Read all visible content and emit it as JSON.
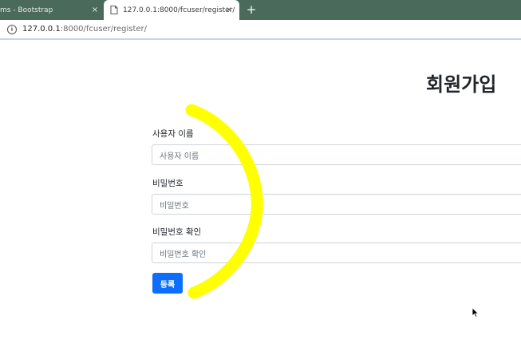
{
  "browser": {
    "tabs": [
      {
        "title": "ms - Bootstrap",
        "active": false
      },
      {
        "title": "127.0.0.1:8000/fcuser/register/",
        "active": true
      }
    ],
    "close_glyph": "×",
    "new_tab_glyph": "+",
    "address": {
      "host": "127.0.0.1",
      "path": ":8000/fcuser/register/"
    },
    "info_glyph": "i"
  },
  "page": {
    "title": "회원가입",
    "fields": [
      {
        "label": "사용자 이름",
        "placeholder": "사용자 이름"
      },
      {
        "label": "비밀번호",
        "placeholder": "비밀번호"
      },
      {
        "label": "비밀번호 확인",
        "placeholder": "비밀번호 확인"
      }
    ],
    "submit_label": "등록"
  },
  "colors": {
    "tabbar": "#4a6a5c",
    "primary_button": "#0d6efd",
    "annotation_stroke": "#ffff00"
  },
  "icons": [
    "info-icon",
    "page-icon",
    "close-icon",
    "new-tab-icon",
    "mouse-cursor-icon"
  ]
}
